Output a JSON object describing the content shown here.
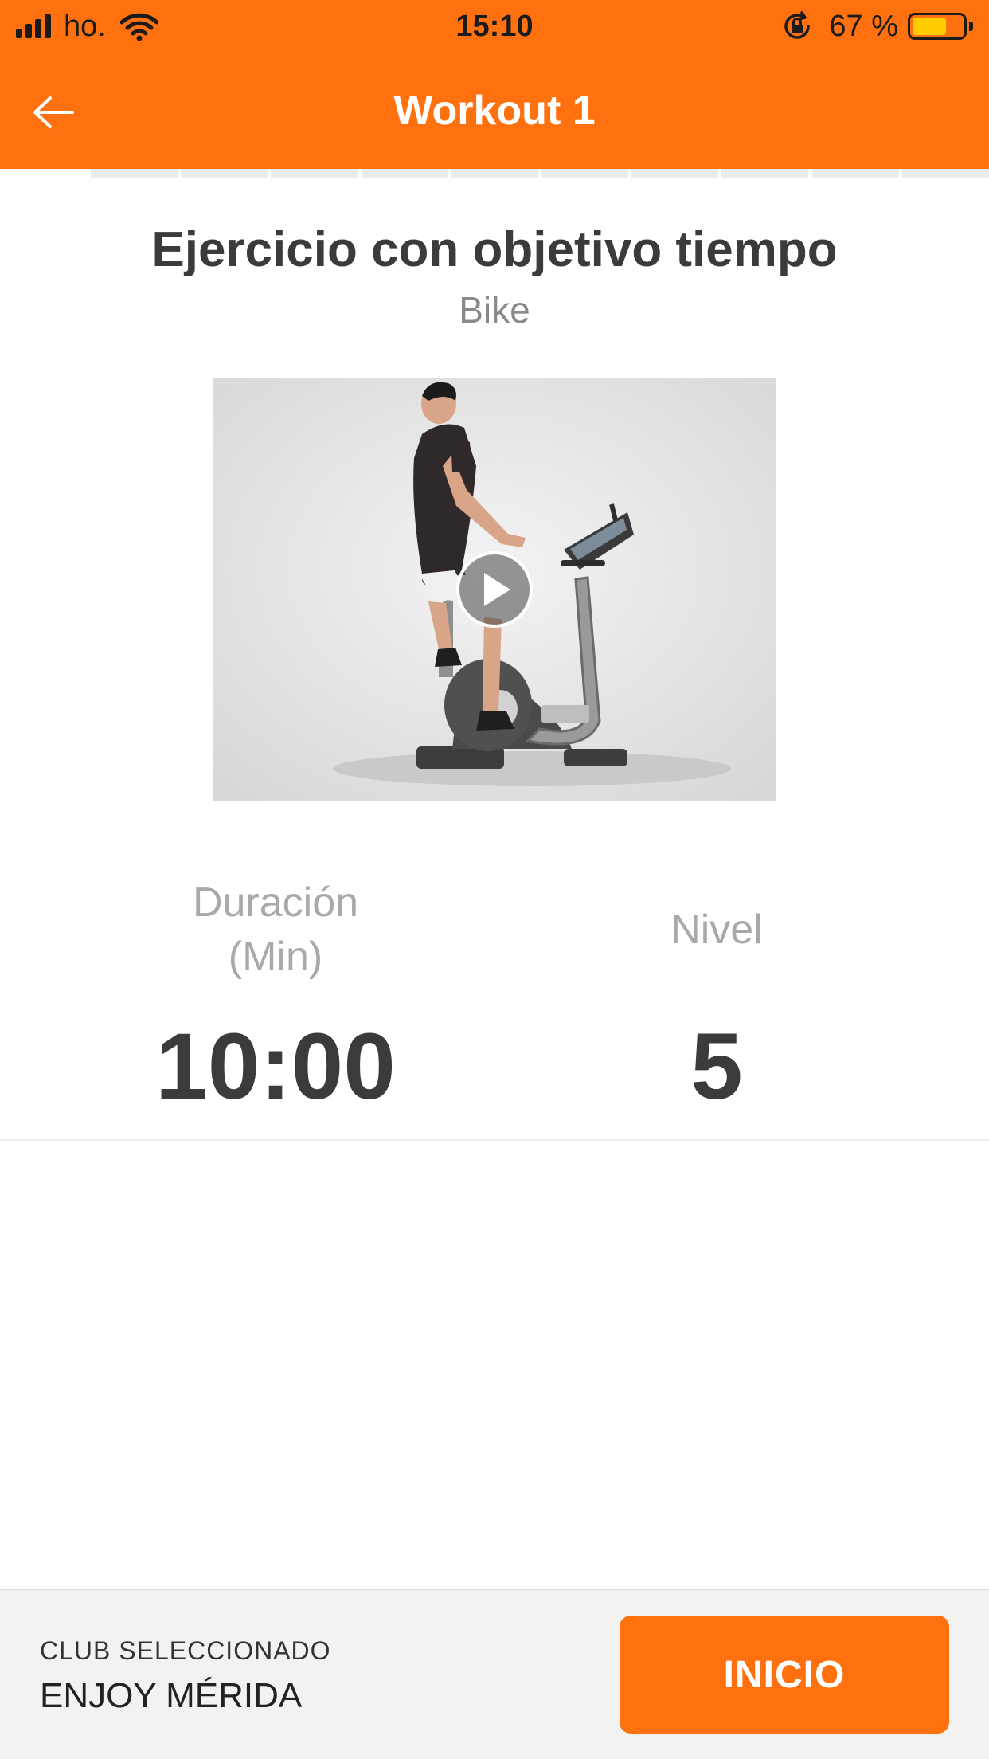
{
  "status_bar": {
    "carrier": "ho.",
    "time": "15:10",
    "battery_percent": "67 %",
    "battery_level": 0.67,
    "icons": [
      "signal-icon",
      "wifi-icon",
      "rotation-lock-icon",
      "battery-icon"
    ]
  },
  "nav": {
    "title": "Workout 1",
    "back_icon": "arrow-left-icon"
  },
  "progress": {
    "total_steps": 11,
    "current_step": 1
  },
  "exercise": {
    "title": "Ejercicio con objetivo tiempo",
    "subtitle": "Bike",
    "video_icon": "play-icon"
  },
  "stats": {
    "duration_label_line1": "Duración",
    "duration_label_line2": "(Min)",
    "duration_value": "10:00",
    "level_label": "Nivel",
    "level_value": "5"
  },
  "footer": {
    "club_caption": "CLUB SELECCIONADO",
    "club_name": "ENJOY MÉRIDA",
    "start_label": "INICIO"
  },
  "colors": {
    "brand_orange": "#ff700f",
    "text_dark": "#3b3b3b",
    "text_muted": "#a9a9a9",
    "battery_yellow": "#ffcc00"
  }
}
